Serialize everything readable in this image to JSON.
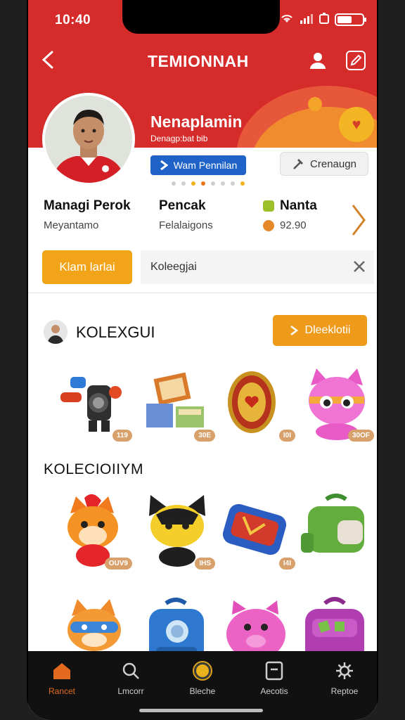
{
  "status_bar": {
    "time": "10:40"
  },
  "header": {
    "title": "TEMIONNAH",
    "profile_name": "Nenaplamin",
    "profile_subtitle": "Denagp:bat bib",
    "follow_label": "Wam Pennilan",
    "create_label": "Crenaugn",
    "page_dots": 8,
    "active_dot": 3
  },
  "stats": [
    {
      "label": "Managi Perok",
      "value": "Meyantamo"
    },
    {
      "label": "Pencak",
      "value": "Felalaigons"
    },
    {
      "label": "Nanta",
      "value": "92.90"
    }
  ],
  "promo": {
    "claim_label": "Klam larlai",
    "field_text": "Koleegjai"
  },
  "collection": {
    "title": "KOLEXGUI",
    "view_label": "Dleeklotii",
    "items": [
      {
        "name": "robot-toy",
        "price": "119"
      },
      {
        "name": "card-boxes",
        "price": "30E"
      },
      {
        "name": "gold-coin",
        "price": "I0I"
      },
      {
        "name": "pink-cat-plush",
        "price": "30OF"
      }
    ]
  },
  "collection2": {
    "title": "KOLECIOIIYM",
    "items": [
      {
        "name": "fox-mascot",
        "price": "OUV9"
      },
      {
        "name": "dog-mascot",
        "price": "IHS"
      },
      {
        "name": "blue-pencil-case",
        "price": "I4I"
      },
      {
        "name": "green-backpack",
        "price": ""
      },
      {
        "name": "fox-hero-plush",
        "price": ""
      },
      {
        "name": "blue-backpack",
        "price": ""
      },
      {
        "name": "pink-pig-plush",
        "price": ""
      },
      {
        "name": "purple-backpack",
        "price": ""
      }
    ]
  },
  "bottom_nav": [
    {
      "label": "Rancet",
      "icon": "home-icon",
      "active": true
    },
    {
      "label": "Lmcorr",
      "icon": "search-icon",
      "active": false
    },
    {
      "label": "Bleche",
      "icon": "coin-icon",
      "active": false
    },
    {
      "label": "Aecotis",
      "icon": "box-icon",
      "active": false
    },
    {
      "label": "Reptoe",
      "icon": "gear-icon",
      "active": false
    }
  ],
  "colors": {
    "brand_red": "#d62b2b",
    "accent_orange": "#f2a418",
    "link_blue": "#1f63c8"
  }
}
